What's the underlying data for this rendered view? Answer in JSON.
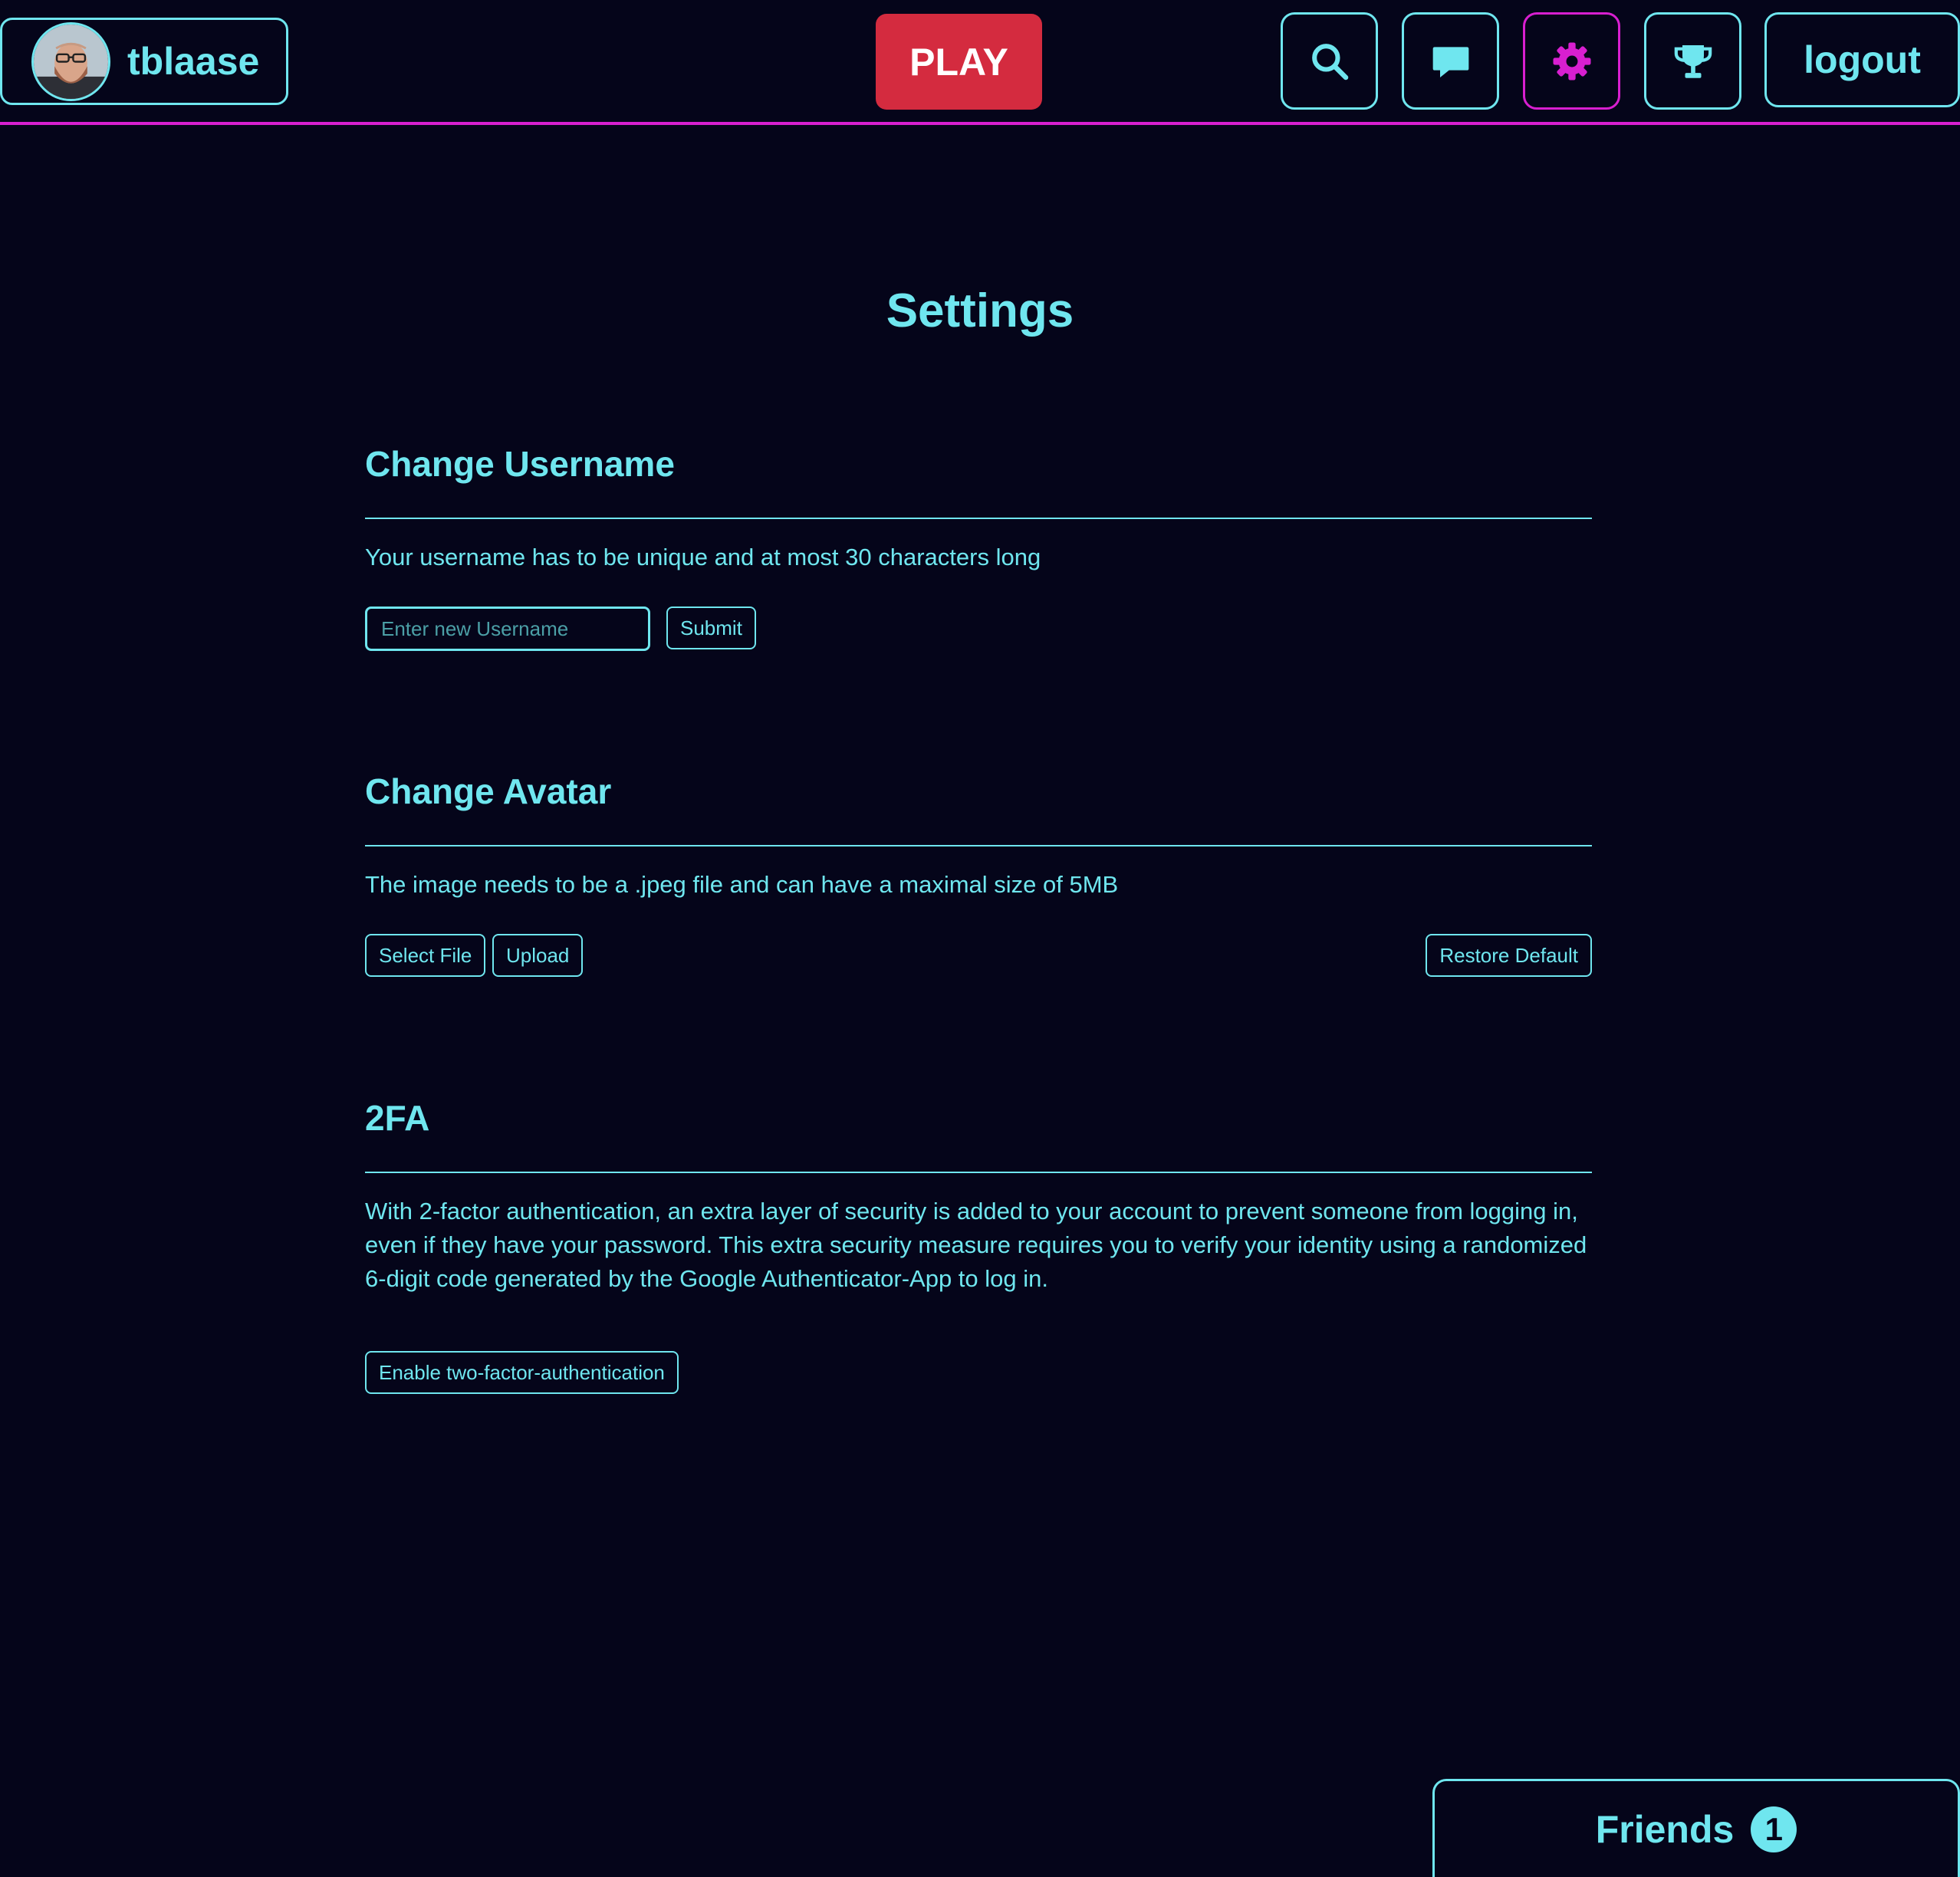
{
  "navbar": {
    "username": "tblaase",
    "play_label": "PLAY",
    "logout_label": "logout",
    "icons": {
      "search": "search-icon",
      "chat": "chat-icon",
      "settings": "gear-icon",
      "leaderboard": "trophy-icon"
    },
    "active_item": "settings"
  },
  "page": {
    "title": "Settings"
  },
  "sections": {
    "username": {
      "heading": "Change Username",
      "description": "Your username has to be unique and at most 30 characters long",
      "input_placeholder": "Enter new Username",
      "input_value": "",
      "submit_label": "Submit"
    },
    "avatar": {
      "heading": "Change Avatar",
      "description": "The image needs to be a .jpeg file and can have a maximal size of 5MB",
      "select_label": "Select File",
      "upload_label": "Upload",
      "restore_label": "Restore Default"
    },
    "twofa": {
      "heading": "2FA",
      "description": "With 2-factor authentication, an extra layer of security is added to your account to prevent someone from logging in, even if they have your password. This extra security measure requires you to verify your identity using a randomized 6-digit code generated by the Google Authenticator-App to log in.",
      "enable_label": "Enable two-factor-authentication"
    }
  },
  "friends": {
    "label": "Friends",
    "count": "1"
  },
  "colors": {
    "background": "#05051a",
    "accent": "#6fe6ef",
    "active_border": "#d81fd0",
    "play": "#d42b3f"
  }
}
